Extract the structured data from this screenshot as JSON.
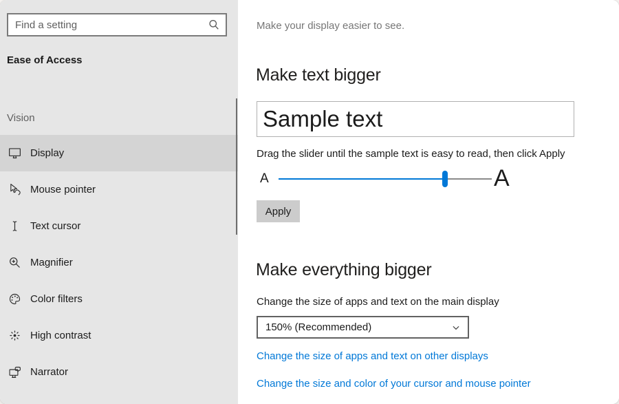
{
  "sidebar": {
    "search": {
      "placeholder": "Find a setting"
    },
    "title": "Ease of Access",
    "section_label": "Vision",
    "items": [
      {
        "label": "Display",
        "icon": "display-icon",
        "selected": true
      },
      {
        "label": "Mouse pointer",
        "icon": "mouse-pointer-icon",
        "selected": false
      },
      {
        "label": "Text cursor",
        "icon": "text-cursor-icon",
        "selected": false
      },
      {
        "label": "Magnifier",
        "icon": "magnifier-icon",
        "selected": false
      },
      {
        "label": "Color filters",
        "icon": "color-filters-icon",
        "selected": false
      },
      {
        "label": "High contrast",
        "icon": "high-contrast-icon",
        "selected": false
      },
      {
        "label": "Narrator",
        "icon": "narrator-icon",
        "selected": false
      }
    ]
  },
  "main": {
    "subtitle": "Make your display easier to see.",
    "make_text_bigger": {
      "heading": "Make text bigger",
      "sample_text": "Sample text",
      "instruction": "Drag the slider until the sample text is easy to read, then click Apply",
      "slider": {
        "min_label": "A",
        "max_label": "A",
        "value_percent": 78
      },
      "apply_label": "Apply"
    },
    "make_everything_bigger": {
      "heading": "Make everything bigger",
      "dropdown_label": "Change the size of apps and text on the main display",
      "dropdown_value": "150% (Recommended)",
      "links": [
        "Change the size of apps and text on other displays",
        "Change the size and color of your cursor and mouse pointer"
      ]
    }
  },
  "colors": {
    "accent": "#0078d7",
    "link": "#0078d7",
    "sidebar_bg": "#e6e6e6",
    "selected_bg": "#d4d4d4"
  }
}
